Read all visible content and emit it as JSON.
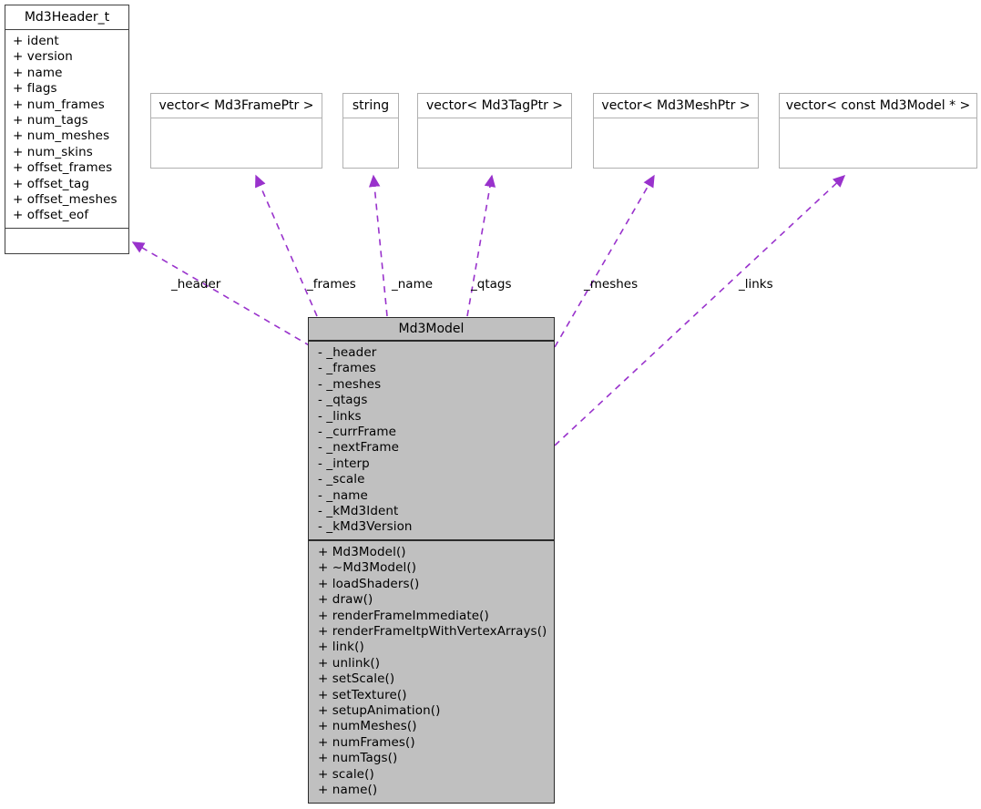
{
  "diagram": {
    "type": "uml-class-collaboration-diagram",
    "accent_color": "#9932cc",
    "filled_class_bg": "#c0c0c0",
    "classes": [
      {
        "id": "md3header",
        "name": "Md3Header_t",
        "attributes": [
          "+ ident",
          "+ version",
          "+ name",
          "+ flags",
          "+ num_frames",
          "+ num_tags",
          "+ num_meshes",
          "+ num_skins",
          "+ offset_frames",
          "+ offset_tag",
          "+ offset_meshes",
          "+ offset_eof"
        ],
        "operations": []
      },
      {
        "id": "vector-framptr",
        "name": "vector< Md3FramePtr >",
        "attributes": [],
        "operations": []
      },
      {
        "id": "string",
        "name": "string",
        "attributes": [],
        "operations": []
      },
      {
        "id": "vector-tagptr",
        "name": "vector< Md3TagPtr >",
        "attributes": [],
        "operations": []
      },
      {
        "id": "vector-meshptr",
        "name": "vector< Md3MeshPtr >",
        "attributes": [],
        "operations": []
      },
      {
        "id": "vector-constmd3model",
        "name": "vector< const Md3Model * >",
        "attributes": [],
        "operations": []
      },
      {
        "id": "md3model",
        "name": "Md3Model",
        "attributes": [
          "- _header",
          "- _frames",
          "- _meshes",
          "- _qtags",
          "- _links",
          "- _currFrame",
          "- _nextFrame",
          "- _interp",
          "- _scale",
          "- _name",
          "- _kMd3Ident",
          "- _kMd3Version"
        ],
        "operations": [
          "+ Md3Model()",
          "+ ~Md3Model()",
          "+ loadShaders()",
          "+ draw()",
          "+ renderFrameImmediate()",
          "+ renderFrameItpWithVertexArrays()",
          "+ link()",
          "+ unlink()",
          "+ setScale()",
          "+ setTexture()",
          "+ setupAnimation()",
          "+ numMeshes()",
          "+ numFrames()",
          "+ numTags()",
          "+ scale()",
          "+ name()"
        ]
      }
    ],
    "edge_labels": [
      {
        "id": "label-header",
        "text": "_header"
      },
      {
        "id": "label-frames",
        "text": "_frames"
      },
      {
        "id": "label-name",
        "text": "_name"
      },
      {
        "id": "label-qtags",
        "text": "_qtags"
      },
      {
        "id": "label-meshes",
        "text": "_meshes"
      },
      {
        "id": "label-links",
        "text": "_links"
      }
    ]
  }
}
